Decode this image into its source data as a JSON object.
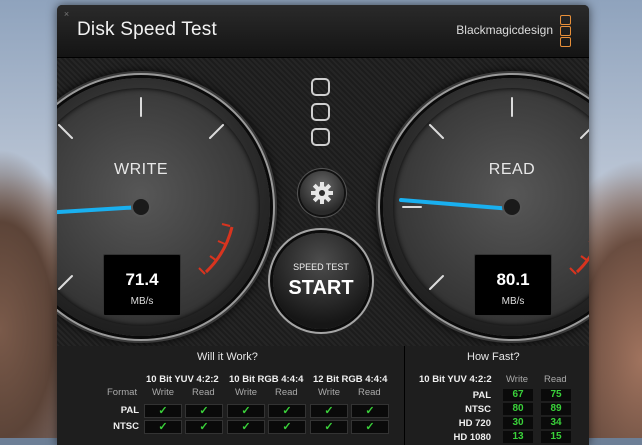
{
  "window": {
    "title": "Disk Speed Test",
    "brand": "Blackmagicdesign",
    "close_glyph": "×"
  },
  "gauges": {
    "write": {
      "label": "WRITE",
      "value": "71.4",
      "unit": "MB/s"
    },
    "read": {
      "label": "READ",
      "value": "80.1",
      "unit": "MB/s"
    }
  },
  "start_button": {
    "sub_label": "SPEED TEST",
    "main_label": "START"
  },
  "will_it_work": {
    "title": "Will it Work?",
    "format_label": "Format",
    "groups": [
      "10 Bit YUV 4:2:2",
      "10 Bit RGB 4:4:4",
      "12 Bit RGB 4:4:4"
    ],
    "sub_headers": [
      "Write",
      "Read"
    ],
    "rows": [
      {
        "format": "PAL",
        "checks": [
          "✓",
          "✓",
          "✓",
          "✓",
          "✓",
          "✓"
        ]
      },
      {
        "format": "NTSC",
        "checks": [
          "✓",
          "✓",
          "✓",
          "✓",
          "✓",
          "✓"
        ]
      }
    ]
  },
  "how_fast": {
    "title": "How Fast?",
    "group": "10 Bit YUV 4:2:2",
    "sub_headers": [
      "Write",
      "Read"
    ],
    "rows": [
      {
        "format": "PAL",
        "write": "67",
        "read": "75"
      },
      {
        "format": "NTSC",
        "write": "80",
        "read": "89"
      },
      {
        "format": "HD 720",
        "write": "30",
        "read": "34"
      },
      {
        "format": "HD 1080",
        "write": "13",
        "read": "15"
      }
    ]
  },
  "colors": {
    "needle": "#19b0f0",
    "redline": "#d8341f",
    "check": "#3ad13a",
    "logo": "#e8903a"
  }
}
